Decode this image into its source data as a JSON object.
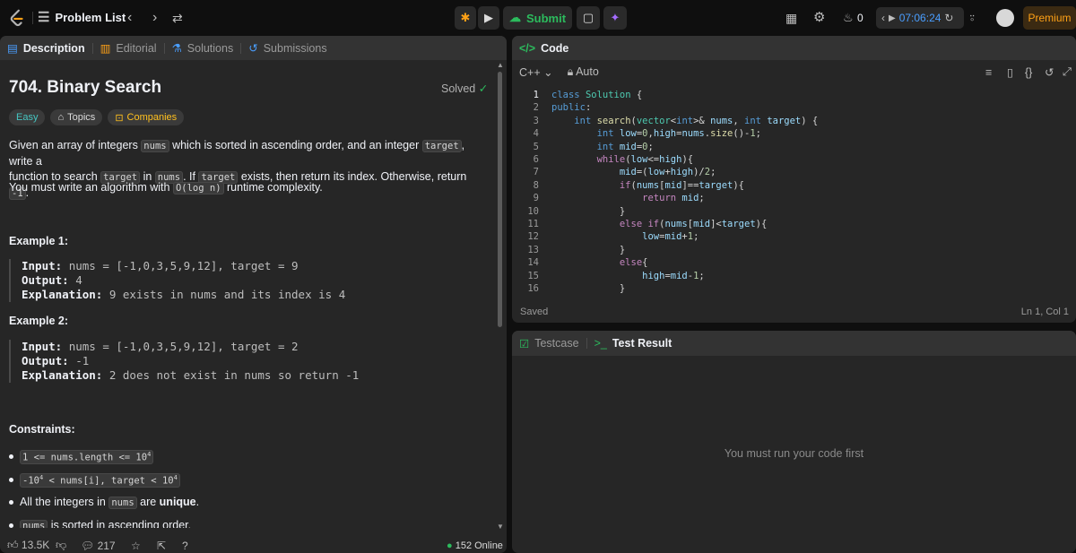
{
  "topbar": {
    "problem_list": "Problem List",
    "submit": "Submit",
    "streak": "0",
    "timer": "07:06:24",
    "premium": "Premium"
  },
  "left_tabs": [
    "Description",
    "Editorial",
    "Solutions",
    "Submissions"
  ],
  "problem": {
    "title": "704. Binary Search",
    "solved": "Solved",
    "tags": [
      "Easy",
      "Topics",
      "Companies"
    ],
    "desc1_a": "Given an array of integers ",
    "desc1_b": "nums",
    "desc1_c": " which is sorted in ascending order, and an integer ",
    "desc1_d": "target",
    "desc1_e": ", write a",
    "desc2_a": "function to search ",
    "desc2_b": "target",
    "desc2_c": " in ",
    "desc2_d": "nums",
    "desc2_e": ". If ",
    "desc2_f": "target",
    "desc2_g": " exists, then return its index. Otherwise, return ",
    "desc2_h": "-1",
    "desc2_i": ".",
    "desc3_a": "You must write an algorithm with ",
    "desc3_b": "O(log n)",
    "desc3_c": " runtime complexity.",
    "ex1_title": "Example 1:",
    "ex1_input": "nums = [-1,0,3,5,9,12], target = 9",
    "ex1_output": "4",
    "ex1_expl": "9 exists in nums and its index is 4",
    "ex2_title": "Example 2:",
    "ex2_input": "nums = [-1,0,3,5,9,12], target = 2",
    "ex2_output": "-1",
    "ex2_expl": "2 does not exist in nums so return -1",
    "input_label": "Input:",
    "output_label": "Output:",
    "expl_label": "Explanation:",
    "constraints_title": "Constraints:",
    "c1_a": "1 <= nums.length <= 10",
    "c1_sup": "4",
    "c2_a": "-10",
    "c2_sup": "4",
    "c2_b": " < nums[i], target < 10",
    "c2_sup2": "4",
    "c3_a": "All the integers in ",
    "c3_b": "nums",
    "c3_c": " are ",
    "c3_d": "unique",
    "c3_e": ".",
    "c4_b": "nums",
    "c4_c": " is sorted in ascending order."
  },
  "footer": {
    "likes": "13.5K",
    "comments": "217",
    "online": "152 Online"
  },
  "code_panel": {
    "title": "Code",
    "lang": "C++",
    "auto": "Auto",
    "saved": "Saved",
    "cursor": "Ln 1, Col 1",
    "line_numbers": [
      "1",
      "2",
      "3",
      "4",
      "5",
      "6",
      "7",
      "8",
      "9",
      "10",
      "11",
      "12",
      "13",
      "14",
      "15",
      "16"
    ]
  },
  "test_panel": {
    "tab1": "Testcase",
    "tab2": "Test Result",
    "empty": "You must run your code first"
  }
}
